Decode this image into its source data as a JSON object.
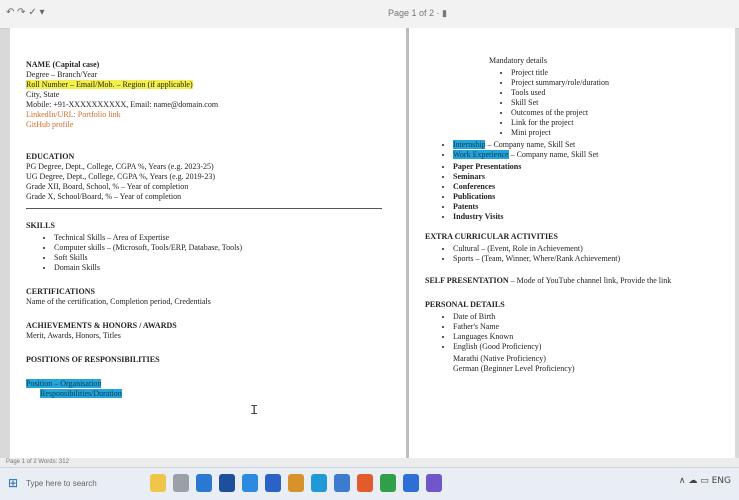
{
  "toolbar": {
    "quick_access": "↶ ↷ ✓ ▾",
    "page_indicator": "Page 1 of 2 · ▮"
  },
  "resume_left": {
    "name": "NAME (Capital case)",
    "line1": "Degree – Branch/Year",
    "highlight_line": "Roll Number – Email/Mob. – Region (if applicable)",
    "line2": "City, State",
    "line3": "Mobile:       +91-XXXXXXXXXX, Email: name@domain.com",
    "linkedin": "LinkedIn/URL: Portfolio link",
    "github": "GitHub profile",
    "education_title": "EDUCATION",
    "education_lines": [
      "PG Degree, Dept., College, CGPA %, Years (e.g. 2023-25)",
      "UG Degree, Dept., College, CGPA %, Years (e.g. 2019-23)",
      "Grade XII, Board, School, % – Year of completion",
      "Grade X, School/Board, % – Year of completion"
    ],
    "skills_title": "SKILLS",
    "skills": [
      "Technical Skills – Area of Expertise",
      "Computer skills – (Microsoft, Tools/ERP, Database, Tools)",
      "Soft Skills",
      "Domain Skills"
    ],
    "certifications_title": "CERTIFICATIONS",
    "certifications_text": "Name of the certification, Completion period, Credentials",
    "achievements_title": "ACHIEVEMENTS & HONORS / AWARDS",
    "achievements_text": "Merit, Awards, Honors, Titles",
    "positions_title": "POSITIONS OF RESPONSIBILITIES",
    "positions_hl1": "Position – Organisation",
    "positions_hl2": "Responsibilities/Duration"
  },
  "resume_right": {
    "mandatory_label": "Mandatory details",
    "project_items": [
      "Project title",
      "Project summary/role/duration",
      "Tools used",
      "Skill Set",
      "Outcomes of the project",
      "Link for the project",
      "Mini project"
    ],
    "hl_items": [
      {
        "hl": "Internship",
        "rest": " – Company name, Skill Set"
      },
      {
        "hl": "Work Experience",
        "rest": " – Company name, Skill Set"
      }
    ],
    "bold_items": [
      "Paper Presentations",
      "Seminars",
      "Conferences",
      "Publications",
      "Patents",
      "Industry Visits"
    ],
    "extra_title": "EXTRA CURRICULAR ACTIVITIES",
    "extra_items": [
      "Cultural – (Event, Role in Achievement)",
      "Sports – (Team, Winner, Where/Rank Achievement)"
    ],
    "self_title": "SELF PRESENTATION",
    "self_text": "– Mode of YouTube channel link, Provide the link",
    "personal_title": "PERSONAL DETAILS",
    "personal_items": [
      "Date of Birth",
      "Father's Name",
      "Languages Known"
    ],
    "personal_last": "English (Good Proficiency)",
    "language_extra": [
      "Marathi (Native Proficiency)",
      "German (Beginner Level Proficiency)"
    ]
  },
  "status_bar": {
    "text": "Page 1 of 2  Words: 312"
  },
  "taskbar": {
    "search_placeholder": "Type here to search",
    "tray": "∧ ☁ ▭ ENG"
  }
}
